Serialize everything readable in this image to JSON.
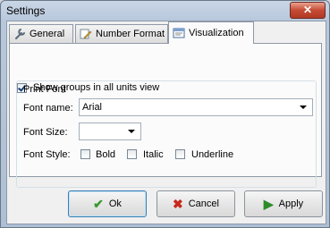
{
  "window": {
    "title": "Settings",
    "close_glyph": "✕"
  },
  "tabs": [
    {
      "label": "General",
      "icon": "wrench-icon"
    },
    {
      "label": "Number Format",
      "icon": "pencil-icon"
    },
    {
      "label": "Visualization",
      "icon": "window-icon"
    }
  ],
  "options": {
    "show_groups_label": "Show groups in all units view",
    "show_groups_checked": true
  },
  "print_font": {
    "group_title": "Print Font",
    "font_name_label": "Font name:",
    "font_name_value": "Arial",
    "font_size_label": "Font Size:",
    "font_size_value": "",
    "font_style_label": "Font Style:",
    "bold_label": "Bold",
    "italic_label": "Italic",
    "underline_label": "Underline"
  },
  "buttons": {
    "ok": "Ok",
    "cancel": "Cancel",
    "apply": "Apply"
  },
  "colors": {
    "ok_icon": "#3a9a2f",
    "cancel_icon": "#c8281e",
    "apply_icon": "#2e8b2a"
  }
}
